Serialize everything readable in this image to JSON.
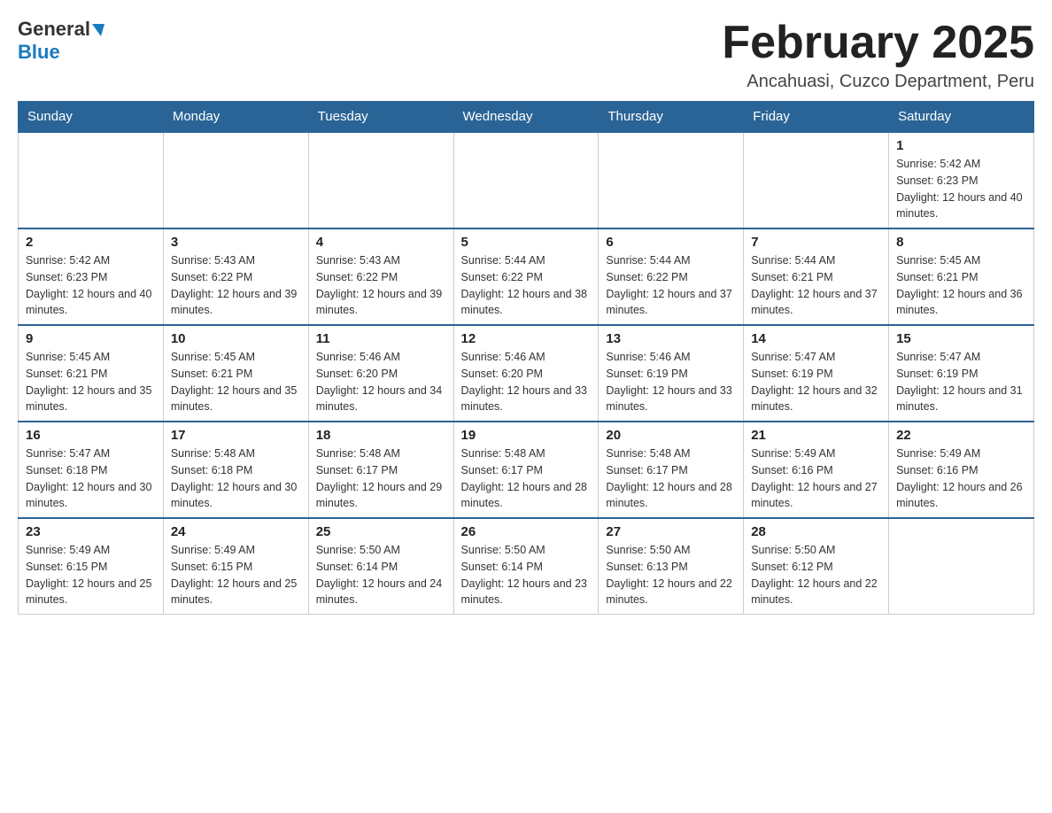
{
  "header": {
    "logo_general": "General",
    "logo_blue": "Blue",
    "month_title": "February 2025",
    "location": "Ancahuasi, Cuzco Department, Peru"
  },
  "days_of_week": [
    "Sunday",
    "Monday",
    "Tuesday",
    "Wednesday",
    "Thursday",
    "Friday",
    "Saturday"
  ],
  "weeks": [
    [
      {
        "day": "",
        "info": ""
      },
      {
        "day": "",
        "info": ""
      },
      {
        "day": "",
        "info": ""
      },
      {
        "day": "",
        "info": ""
      },
      {
        "day": "",
        "info": ""
      },
      {
        "day": "",
        "info": ""
      },
      {
        "day": "1",
        "info": "Sunrise: 5:42 AM\nSunset: 6:23 PM\nDaylight: 12 hours and 40 minutes."
      }
    ],
    [
      {
        "day": "2",
        "info": "Sunrise: 5:42 AM\nSunset: 6:23 PM\nDaylight: 12 hours and 40 minutes."
      },
      {
        "day": "3",
        "info": "Sunrise: 5:43 AM\nSunset: 6:22 PM\nDaylight: 12 hours and 39 minutes."
      },
      {
        "day": "4",
        "info": "Sunrise: 5:43 AM\nSunset: 6:22 PM\nDaylight: 12 hours and 39 minutes."
      },
      {
        "day": "5",
        "info": "Sunrise: 5:44 AM\nSunset: 6:22 PM\nDaylight: 12 hours and 38 minutes."
      },
      {
        "day": "6",
        "info": "Sunrise: 5:44 AM\nSunset: 6:22 PM\nDaylight: 12 hours and 37 minutes."
      },
      {
        "day": "7",
        "info": "Sunrise: 5:44 AM\nSunset: 6:21 PM\nDaylight: 12 hours and 37 minutes."
      },
      {
        "day": "8",
        "info": "Sunrise: 5:45 AM\nSunset: 6:21 PM\nDaylight: 12 hours and 36 minutes."
      }
    ],
    [
      {
        "day": "9",
        "info": "Sunrise: 5:45 AM\nSunset: 6:21 PM\nDaylight: 12 hours and 35 minutes."
      },
      {
        "day": "10",
        "info": "Sunrise: 5:45 AM\nSunset: 6:21 PM\nDaylight: 12 hours and 35 minutes."
      },
      {
        "day": "11",
        "info": "Sunrise: 5:46 AM\nSunset: 6:20 PM\nDaylight: 12 hours and 34 minutes."
      },
      {
        "day": "12",
        "info": "Sunrise: 5:46 AM\nSunset: 6:20 PM\nDaylight: 12 hours and 33 minutes."
      },
      {
        "day": "13",
        "info": "Sunrise: 5:46 AM\nSunset: 6:19 PM\nDaylight: 12 hours and 33 minutes."
      },
      {
        "day": "14",
        "info": "Sunrise: 5:47 AM\nSunset: 6:19 PM\nDaylight: 12 hours and 32 minutes."
      },
      {
        "day": "15",
        "info": "Sunrise: 5:47 AM\nSunset: 6:19 PM\nDaylight: 12 hours and 31 minutes."
      }
    ],
    [
      {
        "day": "16",
        "info": "Sunrise: 5:47 AM\nSunset: 6:18 PM\nDaylight: 12 hours and 30 minutes."
      },
      {
        "day": "17",
        "info": "Sunrise: 5:48 AM\nSunset: 6:18 PM\nDaylight: 12 hours and 30 minutes."
      },
      {
        "day": "18",
        "info": "Sunrise: 5:48 AM\nSunset: 6:17 PM\nDaylight: 12 hours and 29 minutes."
      },
      {
        "day": "19",
        "info": "Sunrise: 5:48 AM\nSunset: 6:17 PM\nDaylight: 12 hours and 28 minutes."
      },
      {
        "day": "20",
        "info": "Sunrise: 5:48 AM\nSunset: 6:17 PM\nDaylight: 12 hours and 28 minutes."
      },
      {
        "day": "21",
        "info": "Sunrise: 5:49 AM\nSunset: 6:16 PM\nDaylight: 12 hours and 27 minutes."
      },
      {
        "day": "22",
        "info": "Sunrise: 5:49 AM\nSunset: 6:16 PM\nDaylight: 12 hours and 26 minutes."
      }
    ],
    [
      {
        "day": "23",
        "info": "Sunrise: 5:49 AM\nSunset: 6:15 PM\nDaylight: 12 hours and 25 minutes."
      },
      {
        "day": "24",
        "info": "Sunrise: 5:49 AM\nSunset: 6:15 PM\nDaylight: 12 hours and 25 minutes."
      },
      {
        "day": "25",
        "info": "Sunrise: 5:50 AM\nSunset: 6:14 PM\nDaylight: 12 hours and 24 minutes."
      },
      {
        "day": "26",
        "info": "Sunrise: 5:50 AM\nSunset: 6:14 PM\nDaylight: 12 hours and 23 minutes."
      },
      {
        "day": "27",
        "info": "Sunrise: 5:50 AM\nSunset: 6:13 PM\nDaylight: 12 hours and 22 minutes."
      },
      {
        "day": "28",
        "info": "Sunrise: 5:50 AM\nSunset: 6:12 PM\nDaylight: 12 hours and 22 minutes."
      },
      {
        "day": "",
        "info": ""
      }
    ]
  ]
}
